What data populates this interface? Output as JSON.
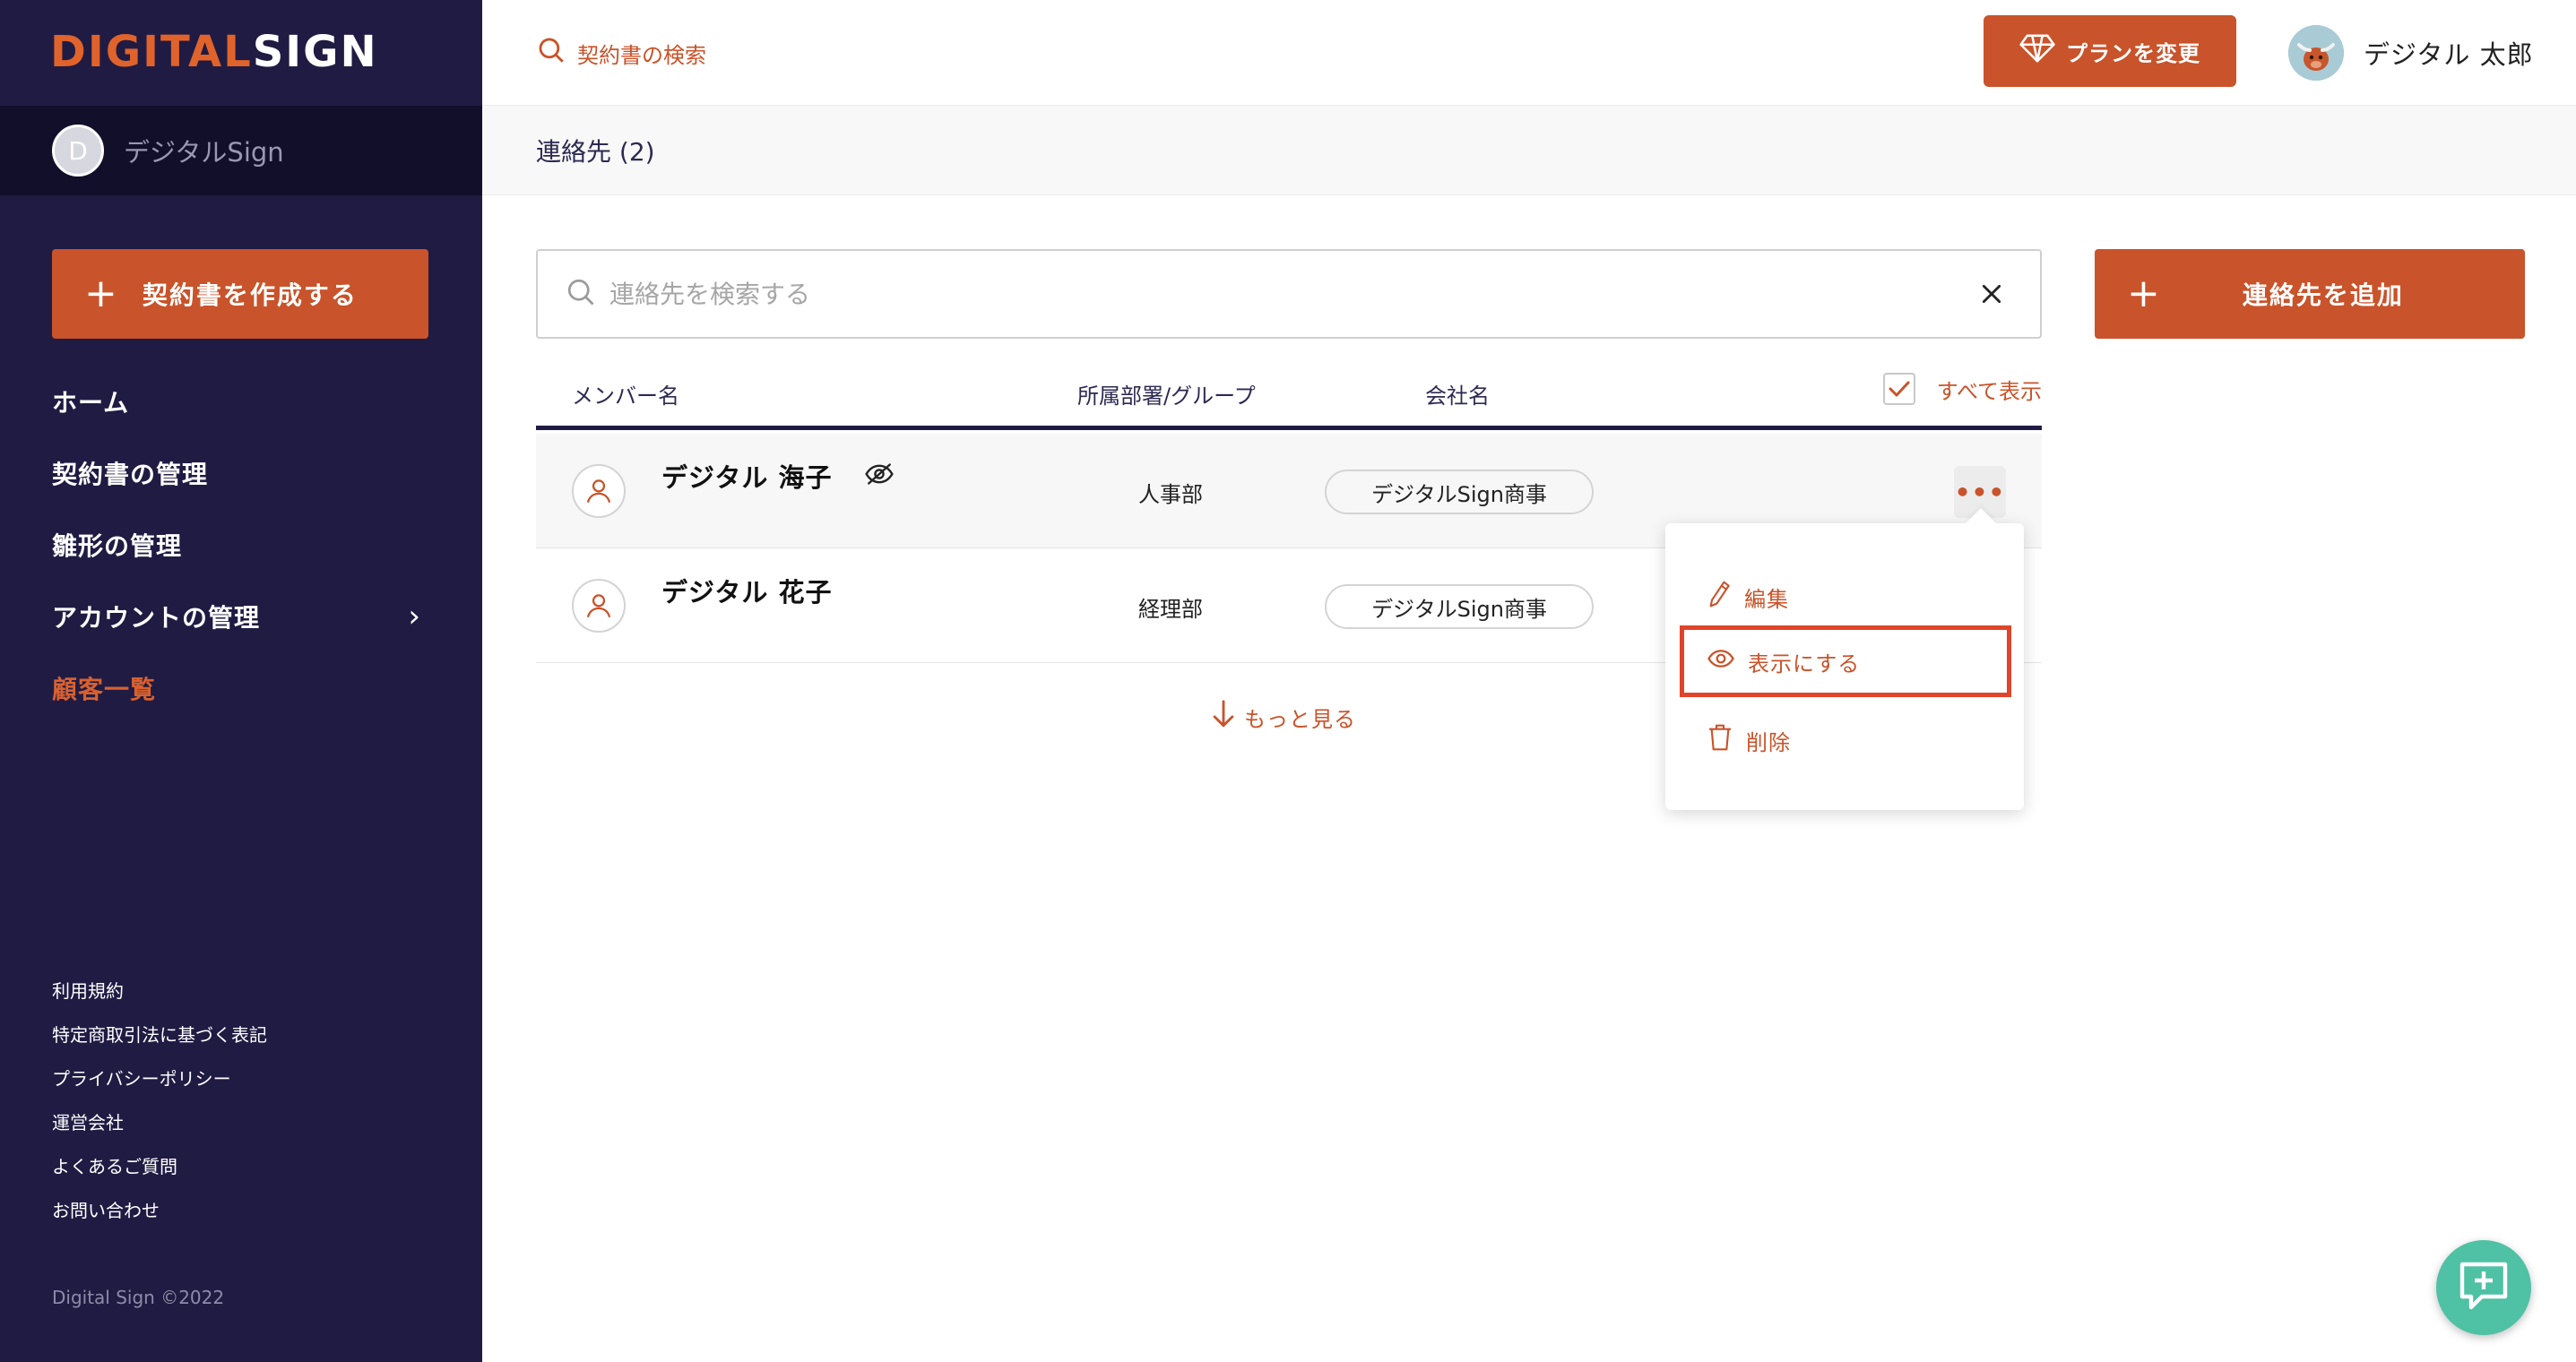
{
  "brand": {
    "logo_part1": "DIGITAL",
    "logo_part2": "SIGN",
    "accent": "#c9532a",
    "sidebar_bg": "#201b43"
  },
  "org": {
    "initial": "D",
    "name": "デジタルSign"
  },
  "sidebar": {
    "create_label": "契約書を作成する",
    "items": [
      {
        "label": "ホーム"
      },
      {
        "label": "契約書の管理"
      },
      {
        "label": "雛形の管理"
      },
      {
        "label": "アカウントの管理",
        "chevron": "›"
      },
      {
        "label": "顧客一覧",
        "active": true
      }
    ],
    "footer_links": [
      {
        "label": "利用規約"
      },
      {
        "label": "特定商取引法に基づく表記"
      },
      {
        "label": "プライバシーポリシー"
      },
      {
        "label": "運営会社"
      },
      {
        "label": "よくあるご質問"
      },
      {
        "label": "お問い合わせ"
      }
    ],
    "copyright": "Digital Sign ©2022"
  },
  "header": {
    "search_label": "契約書の検索",
    "plan_button": "プランを変更",
    "user_name": "デジタル 太郎"
  },
  "breadcrumb": {
    "title": "連絡先 (2)"
  },
  "contacts": {
    "search_placeholder": "連絡先を検索する",
    "add_button": "連絡先を追加",
    "columns": {
      "member": "メンバー名",
      "dept": "所属部署/グループ",
      "company": "会社名"
    },
    "show_all": "すべて表示",
    "rows": [
      {
        "name": "デジタル 海子",
        "dept": "人事部",
        "company": "デジタルSign商事",
        "more": "•••",
        "hidden_icon": "eye-off-icon"
      },
      {
        "name": "デジタル 花子",
        "dept": "経理部",
        "company": "デジタルSign商事"
      }
    ],
    "more_link": "もっと見る"
  },
  "context_menu": {
    "items": [
      {
        "label": "編集",
        "icon": "pencil-icon"
      },
      {
        "label": "表示にする",
        "icon": "eye-icon",
        "highlighted": true
      },
      {
        "label": "削除",
        "icon": "trash-icon"
      }
    ]
  }
}
